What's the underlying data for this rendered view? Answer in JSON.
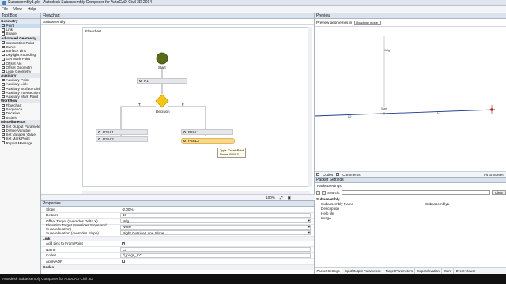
{
  "window": {
    "title": "Subassembly1.pkt - Autodesk Subassembly Composer for AutoCAD Civil 3D 2014"
  },
  "menu": [
    "File",
    "View",
    "Help"
  ],
  "toolbox": {
    "title": "Tool Box",
    "groups": [
      {
        "name": "Geometry",
        "items": [
          "Point",
          "Link",
          "Shape"
        ]
      },
      {
        "name": "Advanced Geometry",
        "items": [
          "Intersection Point",
          "Curve",
          "Surface Link",
          "Daylight Rounding",
          "Get Mark Point",
          "Offset Arc",
          "Offset Geometry",
          "Loop Geometry"
        ]
      },
      {
        "name": "Auxiliary",
        "items": [
          "Auxiliary Point",
          "Auxiliary Link",
          "Auxiliary Surface Link",
          "Auxiliary Intersection",
          "Auxiliary Mark Point"
        ]
      },
      {
        "name": "Workflow",
        "items": [
          "Flowchart",
          "Sequence",
          "Decision",
          "Switch"
        ]
      },
      {
        "name": "Miscellaneous",
        "items": [
          "Set Output Parameter",
          "Define Variable",
          "Set Variable Value",
          "Set Mark Point",
          "Report Message"
        ]
      }
    ]
  },
  "flowchart": {
    "panel_title": "Flowchart",
    "sub_title": "Subassembly",
    "canvas_title": "Flowchart",
    "start_label": "Start",
    "decision_label": "Decision",
    "true_label": "T",
    "false_label": "F",
    "nodes": {
      "p1": "P1",
      "p3l1": "P3&L1",
      "p3l2": "P3&L2",
      "p2l1": "P2&L1",
      "p4l3": "P4&L3"
    },
    "tooltip": {
      "type_label": "Type:",
      "type_value": "CreatePoint",
      "name_label": "Name:",
      "name_value": "P4&L3"
    },
    "zoom": "100%"
  },
  "properties": {
    "title": "Properties",
    "rows": [
      {
        "name": "Slope",
        "value": "-2.00%"
      },
      {
        "name": "Delta X",
        "value": "10"
      },
      {
        "name": "Offset Target (overrides Delta X)",
        "value": "Wfg"
      },
      {
        "name": "Elevation Target (overrides Slope and Superelevation)",
        "value": "None"
      },
      {
        "name": "Superelevation (overrides Slope)",
        "value": "Right Outside Lane Slope"
      }
    ],
    "link_section": "Link",
    "link_rows": [
      {
        "name": "Add Link to From Point",
        "value": "✓"
      },
      {
        "name": "Name",
        "value": "L3"
      },
      {
        "name": "Codes",
        "value": "\"l_pags_ro\""
      },
      {
        "name": "ApplyAOR",
        "value": ""
      }
    ],
    "codes_section": "Codes"
  },
  "preview": {
    "title": "Preview",
    "toolbar_label": "Preview geometries in",
    "mode": "Roadway mode",
    "wfg_label": "Wfg",
    "origin_label": "Start",
    "link_labels": [
      "L2",
      "L1"
    ],
    "codes_label": "Codes",
    "comments_label": "Comments",
    "fit_label": "Fit to Screen"
  },
  "packet": {
    "title": "Packet Settings",
    "tab_title": "PacketSettings",
    "search_label": "Search:",
    "clear_label": "Clear",
    "section": "Subassembly",
    "rows": [
      {
        "key": "Subassembly Name",
        "value": "Subassembly1"
      },
      {
        "key": "Description",
        "value": ""
      },
      {
        "key": "Help file",
        "value": ""
      },
      {
        "key": "Image",
        "value": ""
      }
    ],
    "tabs": [
      "Packet Settings",
      "Input/Output Parameters",
      "Target Parameters",
      "Superelevation",
      "Cant",
      "Event Viewer"
    ]
  },
  "status": {
    "text": "Autodesk Subassembly Composer for AutoCAD Civil 3D"
  },
  "colors": {
    "start_node": "#5a6b1a",
    "decision": "#f5c518",
    "highlight": "#f7d88d",
    "preview_red": "#b32020"
  }
}
